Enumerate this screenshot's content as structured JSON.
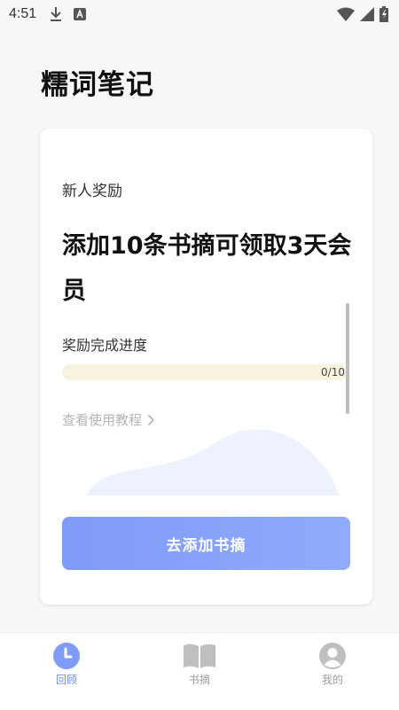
{
  "status_bar": {
    "time": "4:51",
    "icons": [
      "download-icon",
      "app-a-icon",
      "wifi-icon",
      "signal-icon",
      "battery-charging-icon"
    ]
  },
  "page": {
    "title": "糯词笔记"
  },
  "card": {
    "tag": "新人奖励",
    "headline": "添加10条书摘可领取3天会员",
    "progress": {
      "label": "奖励完成进度",
      "current": 0,
      "total": 10,
      "count_text": "0/10"
    },
    "tutorial_link": "查看使用教程",
    "cta_label": "去添加书摘"
  },
  "tabbar": {
    "items": [
      {
        "label": "回顾",
        "icon": "clock-icon",
        "active": true
      },
      {
        "label": "书摘",
        "icon": "book-icon",
        "active": false
      },
      {
        "label": "我的",
        "icon": "profile-icon",
        "active": false
      }
    ]
  },
  "colors": {
    "accent": "#7f9bf8",
    "progress_track": "#f7f3de",
    "wave": "#eef2ff",
    "inactive_icon": "#bfbfbf"
  }
}
